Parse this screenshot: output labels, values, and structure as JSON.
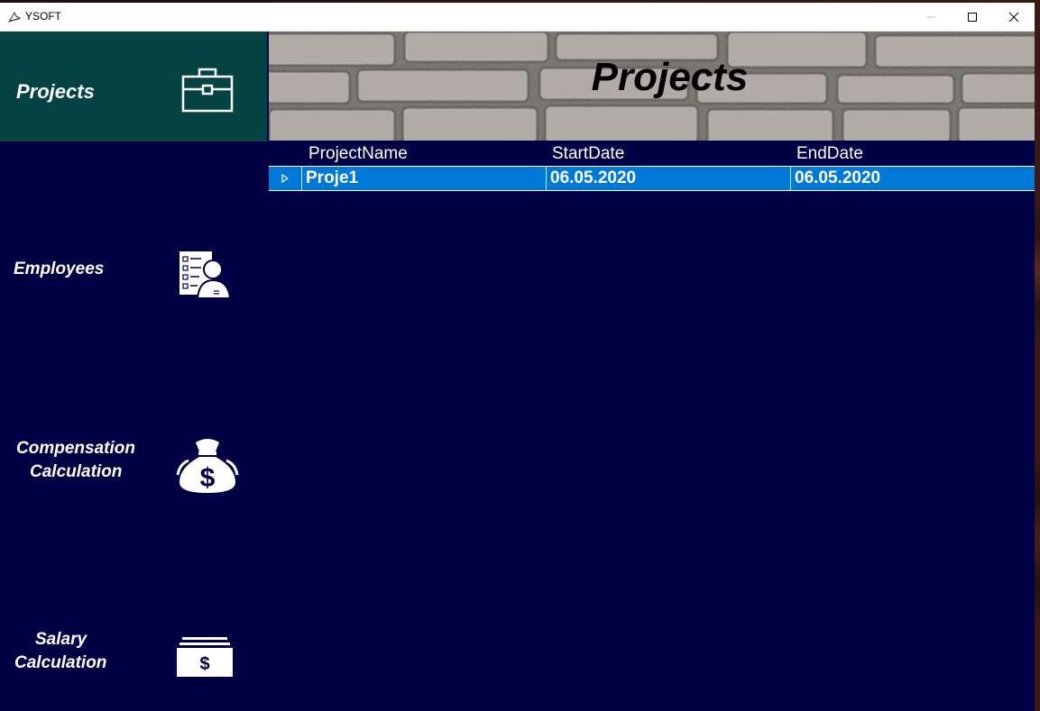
{
  "window": {
    "title": "YSOFT"
  },
  "sidebar": {
    "items": [
      {
        "label": "Projects",
        "icon": "briefcase-icon",
        "active": true
      },
      {
        "label": "Employees",
        "icon": "employee-checklist-icon",
        "active": false
      },
      {
        "label": "Compensation Calculation",
        "line1": "Compensation",
        "line2": "Calculation",
        "icon": "money-bag-icon",
        "active": false
      },
      {
        "label": "Salary Calculation",
        "line1": "Salary",
        "line2": "Calculation",
        "icon": "cash-stack-icon",
        "active": false
      }
    ]
  },
  "header": {
    "title": "Projects"
  },
  "grid": {
    "columns": [
      "ProjectName",
      "StartDate",
      "EndDate"
    ],
    "rows": [
      [
        "Proje1",
        "06.05.2020",
        "06.05.2020"
      ]
    ]
  },
  "colors": {
    "sidebar_bg": "#000045",
    "active_nav_bg": "#054242",
    "selected_row": "#0078d7"
  }
}
